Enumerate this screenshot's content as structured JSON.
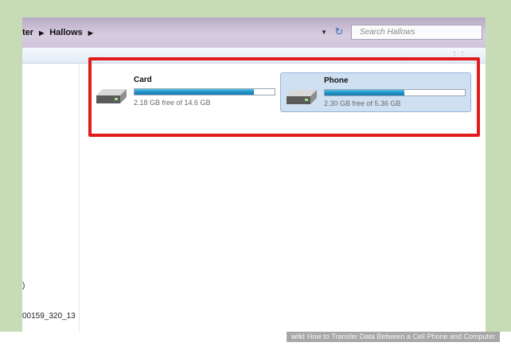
{
  "breadcrumb": {
    "parent": "ter",
    "current": "Hallows"
  },
  "search": {
    "placeholder": "Search Hallows"
  },
  "navpane": {
    "item_a": ")",
    "item_b": "00159_320_13"
  },
  "drives": [
    {
      "name": "Card",
      "free_text": "2.18 GB free of 14.6 GB",
      "used_fraction": 0.85,
      "selected": false
    },
    {
      "name": "Phone",
      "free_text": "2.30 GB free of 5.36 GB",
      "used_fraction": 0.57,
      "selected": true
    }
  ],
  "caption": {
    "brand": "wiki",
    "text": "How to Transfer Data Between a Cell Phone and Computer"
  },
  "colors": {
    "highlight": "#e21b1b",
    "capacity_bar": "#1f8cc4",
    "selected_drive": "#cfe0f2"
  }
}
